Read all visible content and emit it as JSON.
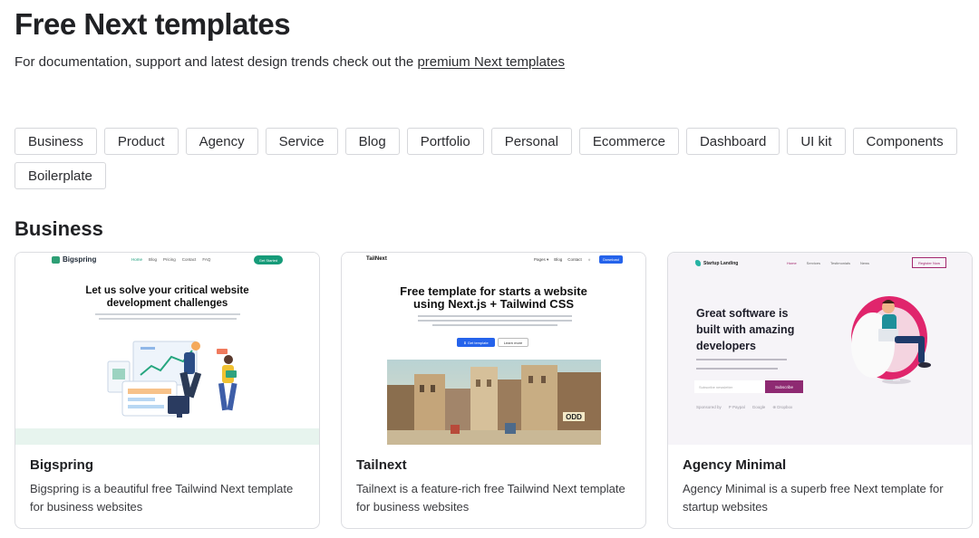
{
  "header": {
    "title": "Free Next templates",
    "subtitle_prefix": "For documentation, support and latest design trends check out the ",
    "subtitle_link": "premium Next templates"
  },
  "filters": [
    "Business",
    "Product",
    "Agency",
    "Service",
    "Blog",
    "Portfolio",
    "Personal",
    "Ecommerce",
    "Dashboard",
    "UI kit",
    "Components",
    "Boilerplate"
  ],
  "section": {
    "title": "Business"
  },
  "cards": [
    {
      "name": "Bigspring",
      "description": "Bigspring is a beautiful free Tailwind Next template for business websites",
      "thumb": {
        "logo": "Bigspring",
        "nav": [
          "Home",
          "Blog",
          "Pricing",
          "Contact",
          "FAQ"
        ],
        "cta": "Get Started",
        "headline_1": "Let us solve your critical website",
        "headline_2": "development challenges"
      }
    },
    {
      "name": "Tailnext",
      "description": "Tailnext is a feature-rich free Tailwind Next template for business websites",
      "thumb": {
        "logo": "TailNext",
        "nav": [
          "Pages ▾",
          "Blog",
          "Contact"
        ],
        "cta": "Download",
        "headline_1": "Free template for starts a website",
        "headline_2": "using Next.js + Tailwind CSS",
        "button_primary": "⬇ Get template",
        "button_secondary": "Learn more",
        "sign": "ODD"
      }
    },
    {
      "name": "Agency Minimal",
      "description": "Agency Minimal is a superb free Next template for startup websites",
      "thumb": {
        "logo": "Startup Landing",
        "nav": [
          "Home",
          "Services",
          "Testimonials",
          "News"
        ],
        "cta": "Register Now",
        "headline_1": "Great software is",
        "headline_2": "built with amazing",
        "headline_3": "developers",
        "input_placeholder": "Subscribe newsletter",
        "subscribe": "Subscribe",
        "brands": [
          "Sponsored by",
          "P Paypal",
          "Google",
          "⊛ Dropbox"
        ]
      }
    }
  ]
}
